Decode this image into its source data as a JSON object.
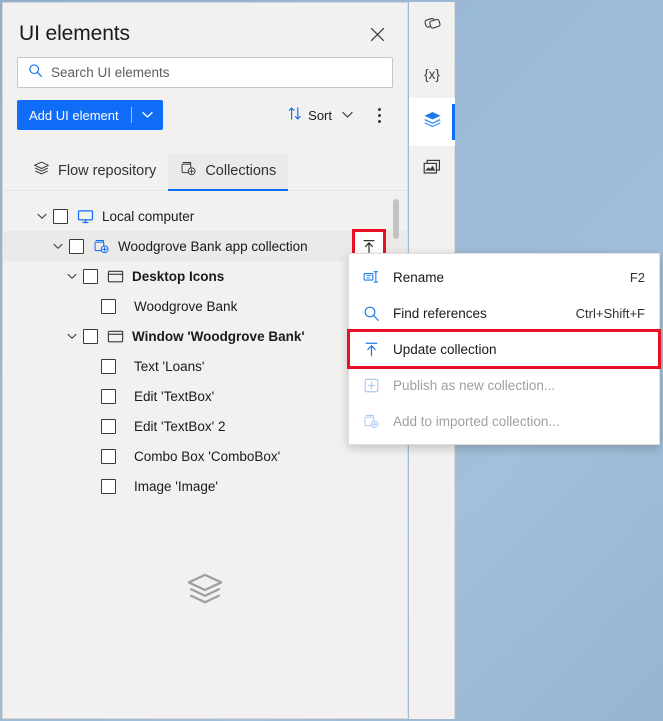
{
  "window": {
    "background_color": "#9cbad6"
  },
  "panel": {
    "title": "UI elements",
    "close_icon": "close-icon",
    "search": {
      "placeholder": "Search UI elements",
      "value": "",
      "icon": "search-icon"
    },
    "commandbar": {
      "add_label": "Add UI element",
      "add_caret_icon": "chevron-down-icon",
      "sort_label": "Sort",
      "sort_icon": "sort-arrows-icon",
      "sort_caret_icon": "chevron-down-icon",
      "more_icon": "more-vertical-icon"
    },
    "tabs": [
      {
        "label": "Flow repository",
        "icon": "layers-icon",
        "active": false
      },
      {
        "label": "Collections",
        "icon": "collection-add-icon",
        "active": true
      }
    ],
    "tree": [
      {
        "label": "Local computer",
        "icon": "monitor-icon",
        "indent": 0,
        "expandable": true,
        "checkbox": true,
        "bold": false,
        "selected": false,
        "action": null
      },
      {
        "label": "Woodgrove Bank app collection",
        "icon": "collection-add-icon",
        "indent": 1,
        "expandable": true,
        "checkbox": true,
        "bold": false,
        "selected": true,
        "action": "upload-icon"
      },
      {
        "label": "Desktop Icons",
        "icon": "window-icon",
        "indent": 2,
        "expandable": true,
        "checkbox": true,
        "bold": true,
        "selected": false,
        "action": null
      },
      {
        "label": "Woodgrove Bank",
        "icon": null,
        "indent": 3,
        "expandable": false,
        "checkbox": true,
        "bold": false,
        "selected": false,
        "action": null
      },
      {
        "label": "Window 'Woodgrove Bank'",
        "icon": "window-icon",
        "indent": 2,
        "expandable": true,
        "checkbox": true,
        "bold": true,
        "selected": false,
        "action": null
      },
      {
        "label": "Text 'Loans'",
        "icon": null,
        "indent": 3,
        "expandable": false,
        "checkbox": true,
        "bold": false,
        "selected": false,
        "action": null
      },
      {
        "label": "Edit 'TextBox'",
        "icon": null,
        "indent": 3,
        "expandable": false,
        "checkbox": true,
        "bold": false,
        "selected": false,
        "action": null
      },
      {
        "label": "Edit 'TextBox' 2",
        "icon": null,
        "indent": 3,
        "expandable": false,
        "checkbox": true,
        "bold": false,
        "selected": false,
        "action": null
      },
      {
        "label": "Combo Box 'ComboBox'",
        "icon": null,
        "indent": 3,
        "expandable": false,
        "checkbox": true,
        "bold": false,
        "selected": false,
        "action": null
      },
      {
        "label": "Image 'Image'",
        "icon": null,
        "indent": 3,
        "expandable": false,
        "checkbox": true,
        "bold": false,
        "selected": false,
        "action": null
      }
    ],
    "empty_state_icon": "layers-icon"
  },
  "context_menu": {
    "items": [
      {
        "label": "Rename",
        "shortcut": "F2",
        "icon": "rename-icon",
        "disabled": false,
        "highlighted": false
      },
      {
        "label": "Find references",
        "shortcut": "Ctrl+Shift+F",
        "icon": "search-icon",
        "disabled": false,
        "highlighted": false
      },
      {
        "label": "Update collection",
        "shortcut": "",
        "icon": "upload-icon",
        "disabled": false,
        "highlighted": true
      },
      {
        "label": "Publish as new collection...",
        "shortcut": "",
        "icon": "plus-box-icon",
        "disabled": true,
        "highlighted": false
      },
      {
        "label": "Add to imported collection...",
        "shortcut": "",
        "icon": "collection-add-icon",
        "disabled": true,
        "highlighted": false
      }
    ]
  },
  "right_rail": {
    "items": [
      {
        "icon": "ui-elements-icon",
        "active": false
      },
      {
        "icon": "variables-icon",
        "active": false,
        "glyph": "{x}"
      },
      {
        "icon": "layers-icon",
        "active": true
      },
      {
        "icon": "images-icon",
        "active": false
      }
    ]
  },
  "colors": {
    "accent": "#0f6cf7",
    "annotation": "#e81123",
    "panel_bg": "#f2f1f0",
    "selected_row": "#eceae8",
    "desktop_blue": "#9cbad6"
  }
}
